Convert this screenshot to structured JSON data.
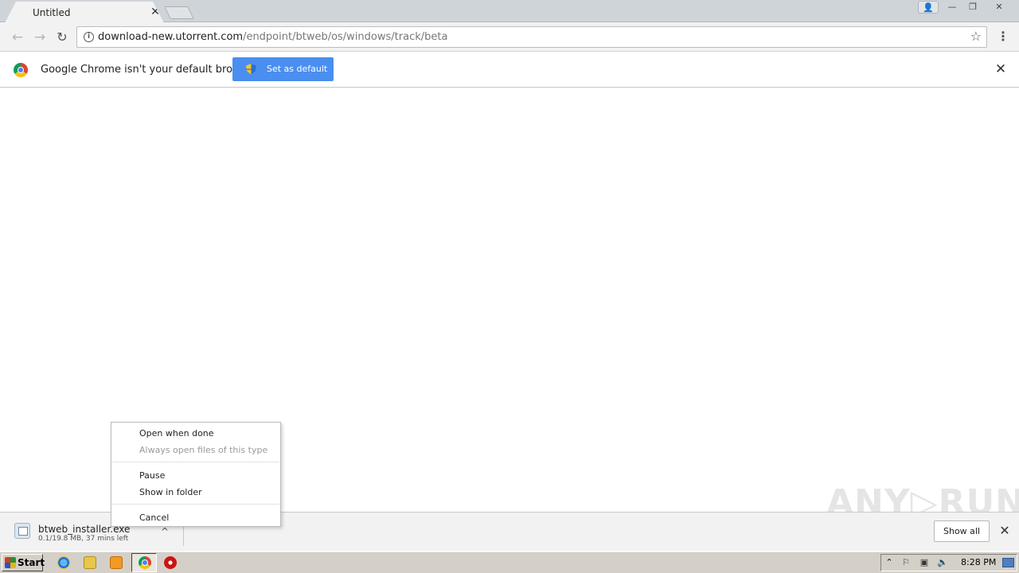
{
  "tab": {
    "title": "Untitled",
    "close_glyph": "✕"
  },
  "window_controls": {
    "profile_glyph": "👤",
    "minimize_glyph": "—",
    "maximize_glyph": "❐",
    "close_glyph": "✕"
  },
  "toolbar": {
    "back_glyph": "←",
    "forward_glyph": "→",
    "reload_glyph": "↻",
    "url_host": "download-new.utorrent.com",
    "url_path": "/endpoint/btweb/os/windows/track/beta",
    "star_glyph": "☆",
    "menu_glyph": "⋮"
  },
  "infobar": {
    "message": "Google Chrome isn't your default browser",
    "button_label": "Set as default",
    "close_glyph": "✕"
  },
  "download": {
    "filename": "btweb_installer.exe",
    "status": "0.1/19.8 MB, 37 mins left",
    "chevron_glyph": "^",
    "show_all_label": "Show all",
    "close_glyph": "✕"
  },
  "context_menu": {
    "items": [
      {
        "label": "Open when done",
        "enabled": true
      },
      {
        "label": "Always open files of this type",
        "enabled": false
      },
      {
        "label": "Pause",
        "enabled": true
      },
      {
        "label": "Show in folder",
        "enabled": true
      },
      {
        "label": "Cancel",
        "enabled": true
      }
    ]
  },
  "watermark": "ANY▷RUN",
  "taskbar": {
    "start_label": "Start",
    "clock": "8:28 PM",
    "tray_expand_glyph": "⌃",
    "tray_flag_glyph": "⚐",
    "tray_network_glyph": "▣",
    "tray_volume_glyph": "🔈"
  },
  "colors": {
    "accent_button": "#4a8ef0",
    "tab_strip": "#cfd4d9",
    "toolbar": "#f2f2f2",
    "taskbar": "#d4d0c8"
  }
}
